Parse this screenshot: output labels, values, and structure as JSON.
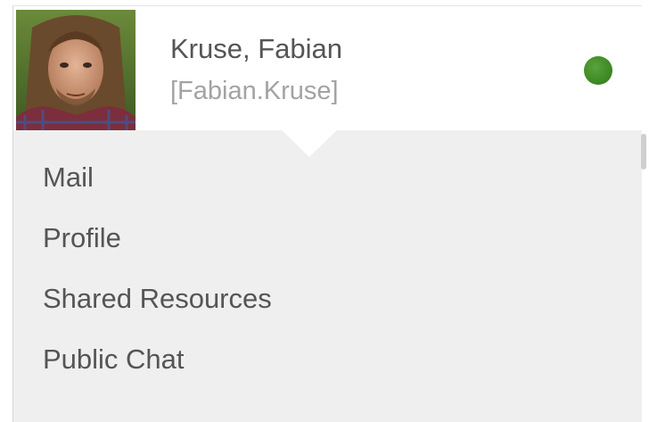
{
  "user": {
    "name": "Kruse, Fabian",
    "login": "[Fabian.Kruse]",
    "status_color": "#3f8a26",
    "avatar_icon": "user-photo"
  },
  "menu": {
    "items": [
      {
        "label": "Mail"
      },
      {
        "label": "Profile"
      },
      {
        "label": "Shared Resources"
      },
      {
        "label": "Public Chat"
      }
    ]
  },
  "colors": {
    "header_bg": "#ffffff",
    "menu_bg": "#efefef",
    "text_primary": "#555555",
    "text_secondary": "#a3a3a3"
  }
}
